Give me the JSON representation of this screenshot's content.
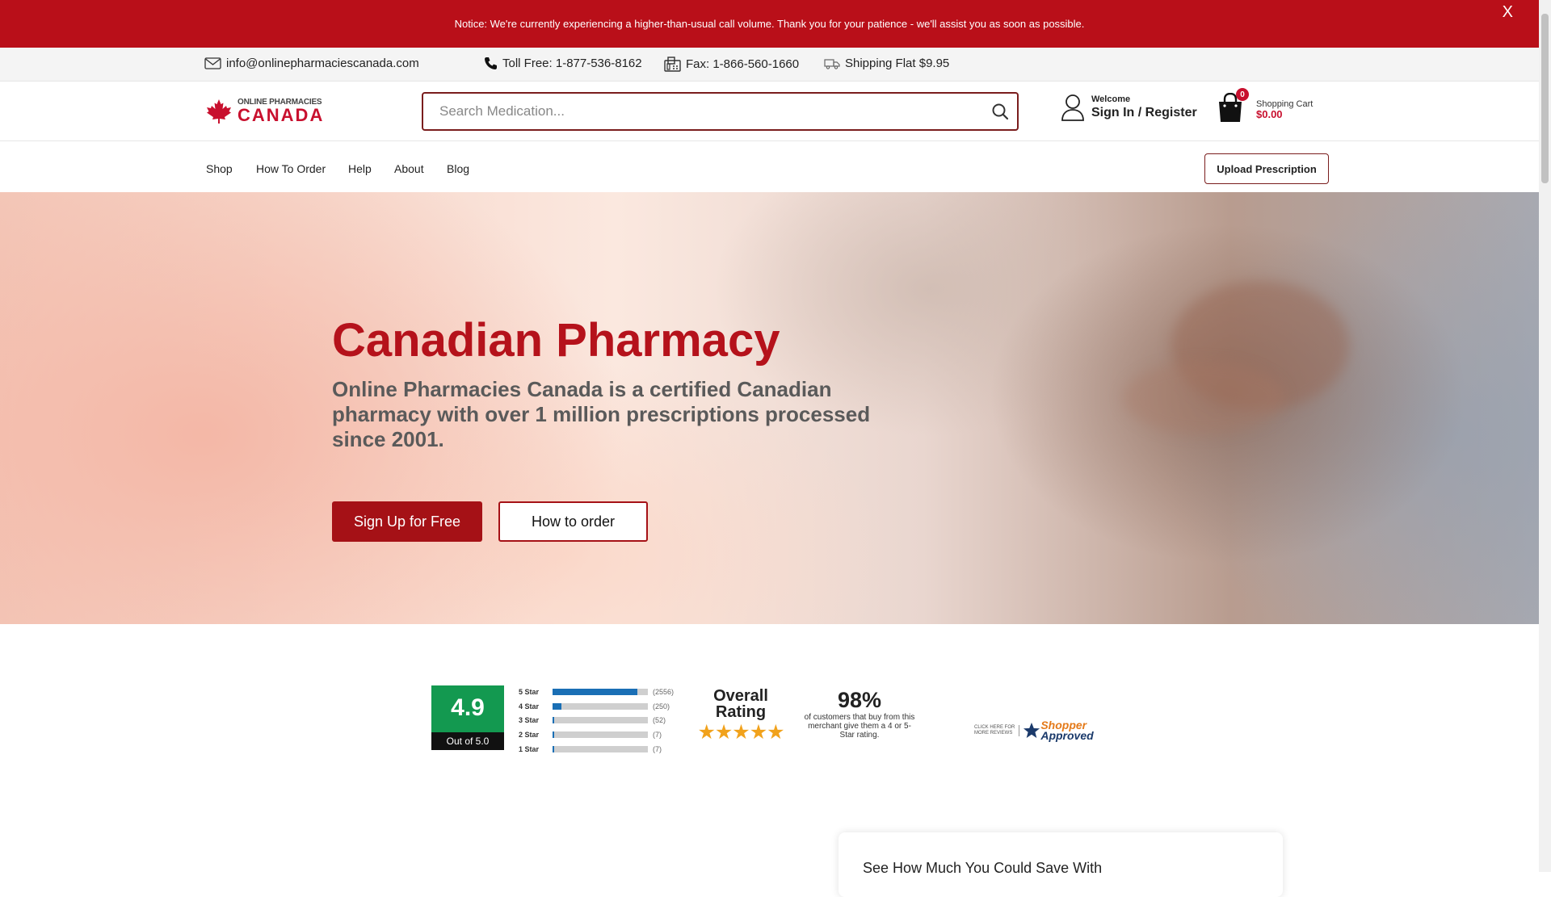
{
  "notice": {
    "text": "Notice: We're currently experiencing a higher-than-usual call volume. Thank you for your patience - we'll assist you as soon as possible.",
    "close": "X"
  },
  "infobar": {
    "email": "info@onlinepharmaciescanada.com",
    "phone": "Toll Free: 1-877-536-8162",
    "fax": "Fax: 1-866-560-1660",
    "shipping": "Shipping Flat $9.95"
  },
  "header": {
    "logo_top": "ONLINE PHARMACIES",
    "logo_bottom": "CANADA",
    "search_placeholder": "Search Medication...",
    "welcome": "Welcome",
    "signin": "Sign In / Register",
    "cart_count": "0",
    "cart_label": "Shopping Cart",
    "cart_total": "$0.00"
  },
  "nav": {
    "items": [
      "Shop",
      "How To Order",
      "Help",
      "About",
      "Blog"
    ],
    "upload": "Upload Prescription"
  },
  "hero": {
    "title": "Canadian Pharmacy",
    "subtitle": "Online Pharmacies Canada is a certified Canadian pharmacy with over 1 million prescriptions processed since 2001.",
    "primary_button": "Sign Up for Free",
    "secondary_button": "How to order"
  },
  "ratings": {
    "score": "4.9",
    "out_of": "Out of 5.0",
    "breakdown": [
      {
        "label": "5 Star",
        "count": "(2556)",
        "fraction": 0.89
      },
      {
        "label": "4 Star",
        "count": "(250)",
        "fraction": 0.09
      },
      {
        "label": "3 Star",
        "count": "(52)",
        "fraction": 0.02
      },
      {
        "label": "2 Star",
        "count": "(7)",
        "fraction": 0.005
      },
      {
        "label": "1 Star",
        "count": "(7)",
        "fraction": 0.005
      }
    ],
    "overall_line1": "Overall",
    "overall_line2": "Rating",
    "stars": "★★★★★",
    "percent": "98%",
    "percent_text": "of customers that buy from this merchant give them a 4 or 5-Star rating.",
    "approved_small_1": "CLICK HERE FOR",
    "approved_small_2": "MORE REVIEWS",
    "approved_brand_1": "Shopper",
    "approved_brand_2": "Approved"
  },
  "savings": {
    "title": "See How Much You Could Save With"
  },
  "colors": {
    "brand_red": "#b5121b",
    "notice_red": "#b90f19",
    "rating_green": "#139950",
    "bar_blue": "#1a6fb5",
    "star_orange": "#f1a21c"
  }
}
